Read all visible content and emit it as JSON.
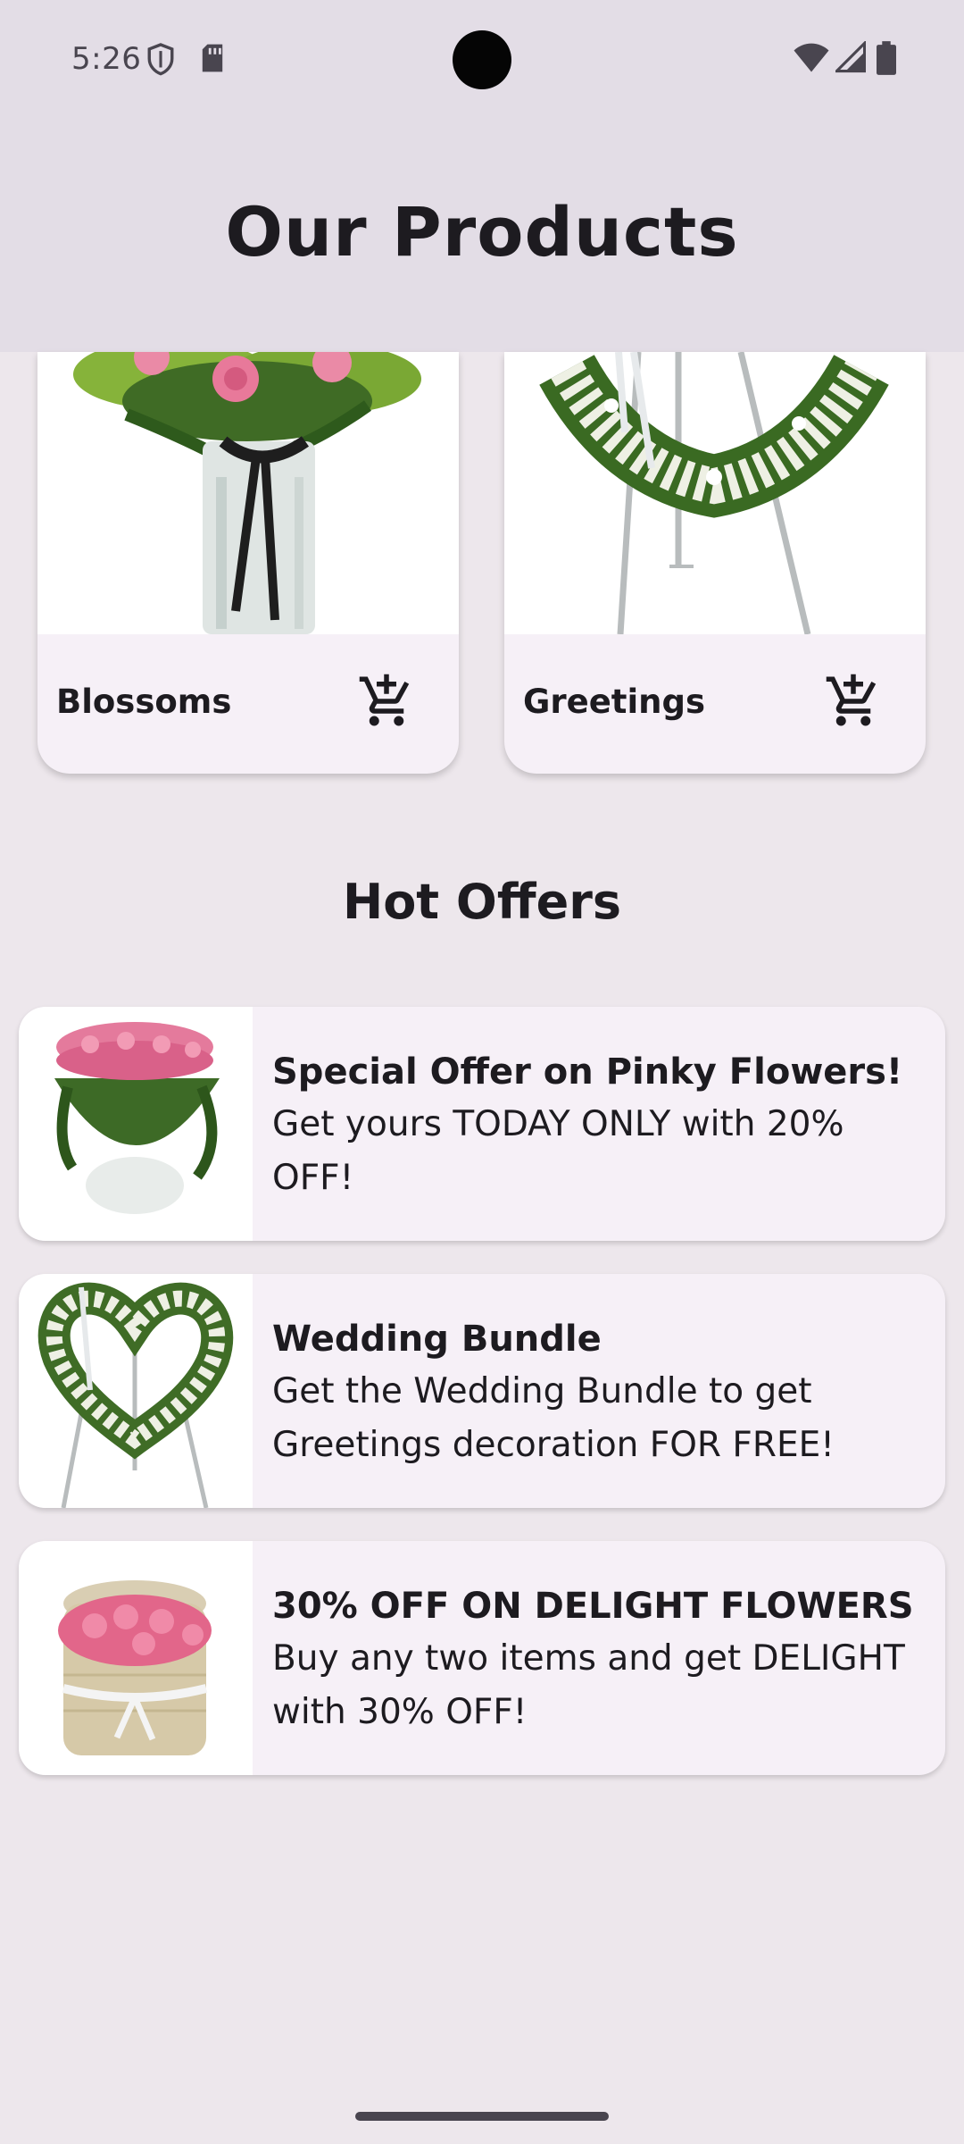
{
  "status_bar": {
    "time": "5:26",
    "icons": [
      "shield-icon",
      "sd-card-icon",
      "wifi-icon",
      "cell-signal-icon",
      "battery-icon"
    ]
  },
  "header": {
    "title": "Our Products"
  },
  "products": [
    {
      "name": "Blossoms",
      "image": "pink-roses-vase",
      "action_icon": "add-shopping-cart-icon"
    },
    {
      "name": "Greetings",
      "image": "white-flower-wreath-stand",
      "action_icon": "add-shopping-cart-icon"
    }
  ],
  "offers_section": {
    "title": "Hot Offers"
  },
  "offers": [
    {
      "title": "Special Offer on Pinky Flowers!",
      "description": "Get yours TODAY ONLY with 20% OFF!",
      "image": "pink-rose-arrangement"
    },
    {
      "title": "Wedding Bundle",
      "description": "Get the Wedding Bundle to get Greetings decoration FOR FREE!",
      "image": "heart-wreath-stand"
    },
    {
      "title": "30% OFF ON DELIGHT FLOWERS",
      "description": "Buy any two items and get DELIGHT with 30% OFF!",
      "image": "rose-box-with-ribbon"
    }
  ],
  "colors": {
    "background": "#ede7ec",
    "header_background": "#e3dde6",
    "card_background": "#f6f0f7",
    "text": "#1d1b20",
    "icon": "#49454f"
  }
}
